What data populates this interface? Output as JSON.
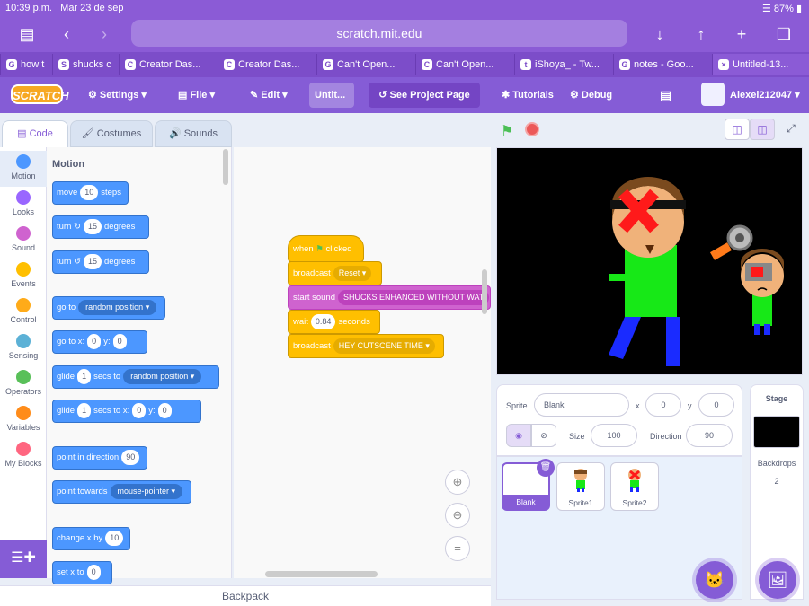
{
  "status": {
    "time": "10:39 p.m.",
    "date": "Mar 23 de sep",
    "battery": "87%"
  },
  "browser": {
    "url": "scratch.mit.edu",
    "tabs": [
      {
        "label": "how t",
        "fav": "G"
      },
      {
        "label": "shucks c",
        "fav": "S"
      },
      {
        "label": "Creator Das...",
        "fav": "C"
      },
      {
        "label": "Creator Das...",
        "fav": "C"
      },
      {
        "label": "Can't Open...",
        "fav": "G"
      },
      {
        "label": "Can't Open...",
        "fav": "C"
      },
      {
        "label": "iShoya_ - Tw...",
        "fav": "t"
      },
      {
        "label": "notes - Goo...",
        "fav": "G"
      },
      {
        "label": "Untitled-13...",
        "fav": "×"
      }
    ]
  },
  "menu": {
    "logo": "SCRATCH",
    "settings": "Settings",
    "file": "File",
    "edit": "Edit",
    "project_title": "Untit...",
    "see_project": "See Project Page",
    "tutorials": "Tutorials",
    "debug": "Debug",
    "username": "Alexei212047"
  },
  "editor_tabs": {
    "code": "Code",
    "costumes": "Costumes",
    "sounds": "Sounds"
  },
  "categories": [
    {
      "label": "Motion",
      "color": "#4c97ff"
    },
    {
      "label": "Looks",
      "color": "#9966ff"
    },
    {
      "label": "Sound",
      "color": "#cf63cf"
    },
    {
      "label": "Events",
      "color": "#ffbf00"
    },
    {
      "label": "Control",
      "color": "#ffab19"
    },
    {
      "label": "Sensing",
      "color": "#5cb1d6"
    },
    {
      "label": "Operators",
      "color": "#59c059"
    },
    {
      "label": "Variables",
      "color": "#ff8c1a"
    },
    {
      "label": "My Blocks",
      "color": "#ff6680"
    }
  ],
  "palette": {
    "title": "Motion",
    "move": {
      "a": "move",
      "v": "10",
      "b": "steps"
    },
    "turn_right": {
      "a": "turn",
      "v": "15",
      "b": "degrees"
    },
    "turn_left": {
      "a": "turn",
      "v": "15",
      "b": "degrees"
    },
    "goto": {
      "a": "go to",
      "dd": "random position"
    },
    "gotoxy": {
      "a": "go to x:",
      "x": "0",
      "b": "y:",
      "y": "0"
    },
    "glide_to": {
      "a": "glide",
      "v": "1",
      "b": "secs to",
      "dd": "random position"
    },
    "glide_xy": {
      "a": "glide",
      "v": "1",
      "b": "secs to x:",
      "x": "0",
      "c": "y:",
      "y": "0"
    },
    "point_dir": {
      "a": "point in direction",
      "v": "90"
    },
    "point_towards": {
      "a": "point towards",
      "dd": "mouse-pointer"
    },
    "change_x": {
      "a": "change x by",
      "v": "10"
    },
    "set_x": {
      "a": "set x to",
      "v": "0"
    }
  },
  "script": {
    "hat": {
      "a": "when",
      "b": "clicked"
    },
    "broadcast1": {
      "a": "broadcast",
      "dd": "Reset"
    },
    "sound": {
      "a": "start sound",
      "dd": "SHUCKS ENHANCED WITHOUT WAT"
    },
    "wait": {
      "a": "wait",
      "v": "0.84",
      "b": "seconds"
    },
    "broadcast2": {
      "a": "broadcast",
      "dd": "HEY CUTSCENE TIME"
    }
  },
  "backpack": "Backpack",
  "sprite_info": {
    "sprite_label": "Sprite",
    "sprite_name": "Blank",
    "x_label": "x",
    "x": "0",
    "y_label": "y",
    "y": "0",
    "size_label": "Size",
    "size": "100",
    "direction_label": "Direction",
    "direction": "90"
  },
  "sprites": [
    {
      "name": "Blank"
    },
    {
      "name": "Sprite1"
    },
    {
      "name": "Sprite2"
    }
  ],
  "stage_panel": {
    "title": "Stage",
    "backdrops_label": "Backdrops",
    "backdrops_count": "2"
  },
  "colors": {
    "accent": "#855cd6",
    "motion": "#4c97ff",
    "events": "#ffbf00",
    "sound": "#cf63cf"
  }
}
